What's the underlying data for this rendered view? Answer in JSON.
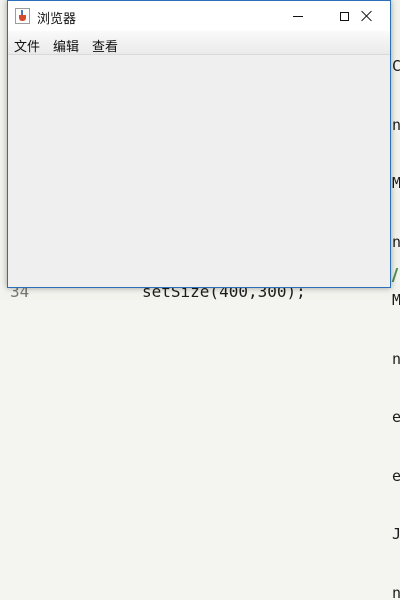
{
  "background": {
    "right_chars": [
      "C",
      "n",
      "M",
      "n",
      "M",
      "n",
      "e",
      "e",
      "J",
      "n"
    ],
    "bottom_line": {
      "line_number": "34",
      "code": "setSize(400,300);"
    }
  },
  "window": {
    "title": "浏览器",
    "icon": "java-cup-icon",
    "controls": [
      "minimize-icon",
      "maximize-icon",
      "close-icon"
    ]
  },
  "menu": {
    "items": [
      {
        "label": "文件"
      },
      {
        "label": "编辑"
      },
      {
        "label": "查看"
      }
    ]
  },
  "colors": {
    "window_border": "#2a6fb8",
    "window_bg": "#efefef",
    "titlebar_bg": "#ffffff"
  }
}
